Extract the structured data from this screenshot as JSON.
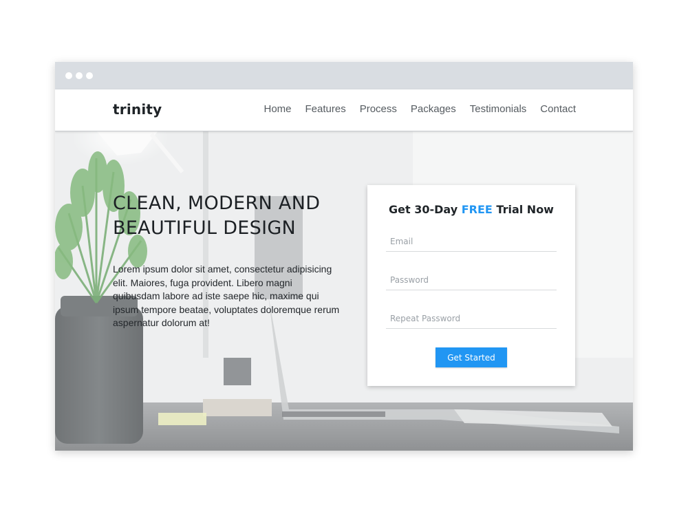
{
  "browser": {
    "traffic_lights": [
      "dot",
      "dot",
      "dot"
    ]
  },
  "brand": {
    "name": "trinity"
  },
  "nav": {
    "items": [
      "Home",
      "Features",
      "Process",
      "Packages",
      "Testimonials",
      "Contact"
    ]
  },
  "hero": {
    "headline": "CLEAN, MODERN AND BEAUTIFUL DESIGN",
    "lead": "Lorem ipsum dolor sit amet, consectetur adipisicing elit. Maiores, fuga provident. Libero magni quibusdam labore ad iste saepe hic, maxime qui ipsum tempore beatae, voluptates doloremque rerum aspernatur dolorum at!"
  },
  "signup": {
    "title_prefix": "Get 30-Day ",
    "title_highlight": "FREE",
    "title_suffix": " Trial Now",
    "email_placeholder": "Email",
    "password_placeholder": "Password",
    "repeat_password_placeholder": "Repeat Password",
    "button_label": "Get Started"
  },
  "colors": {
    "accent": "#2196f3",
    "titlebar": "#d9dde2",
    "text_dark": "#1f2428"
  }
}
